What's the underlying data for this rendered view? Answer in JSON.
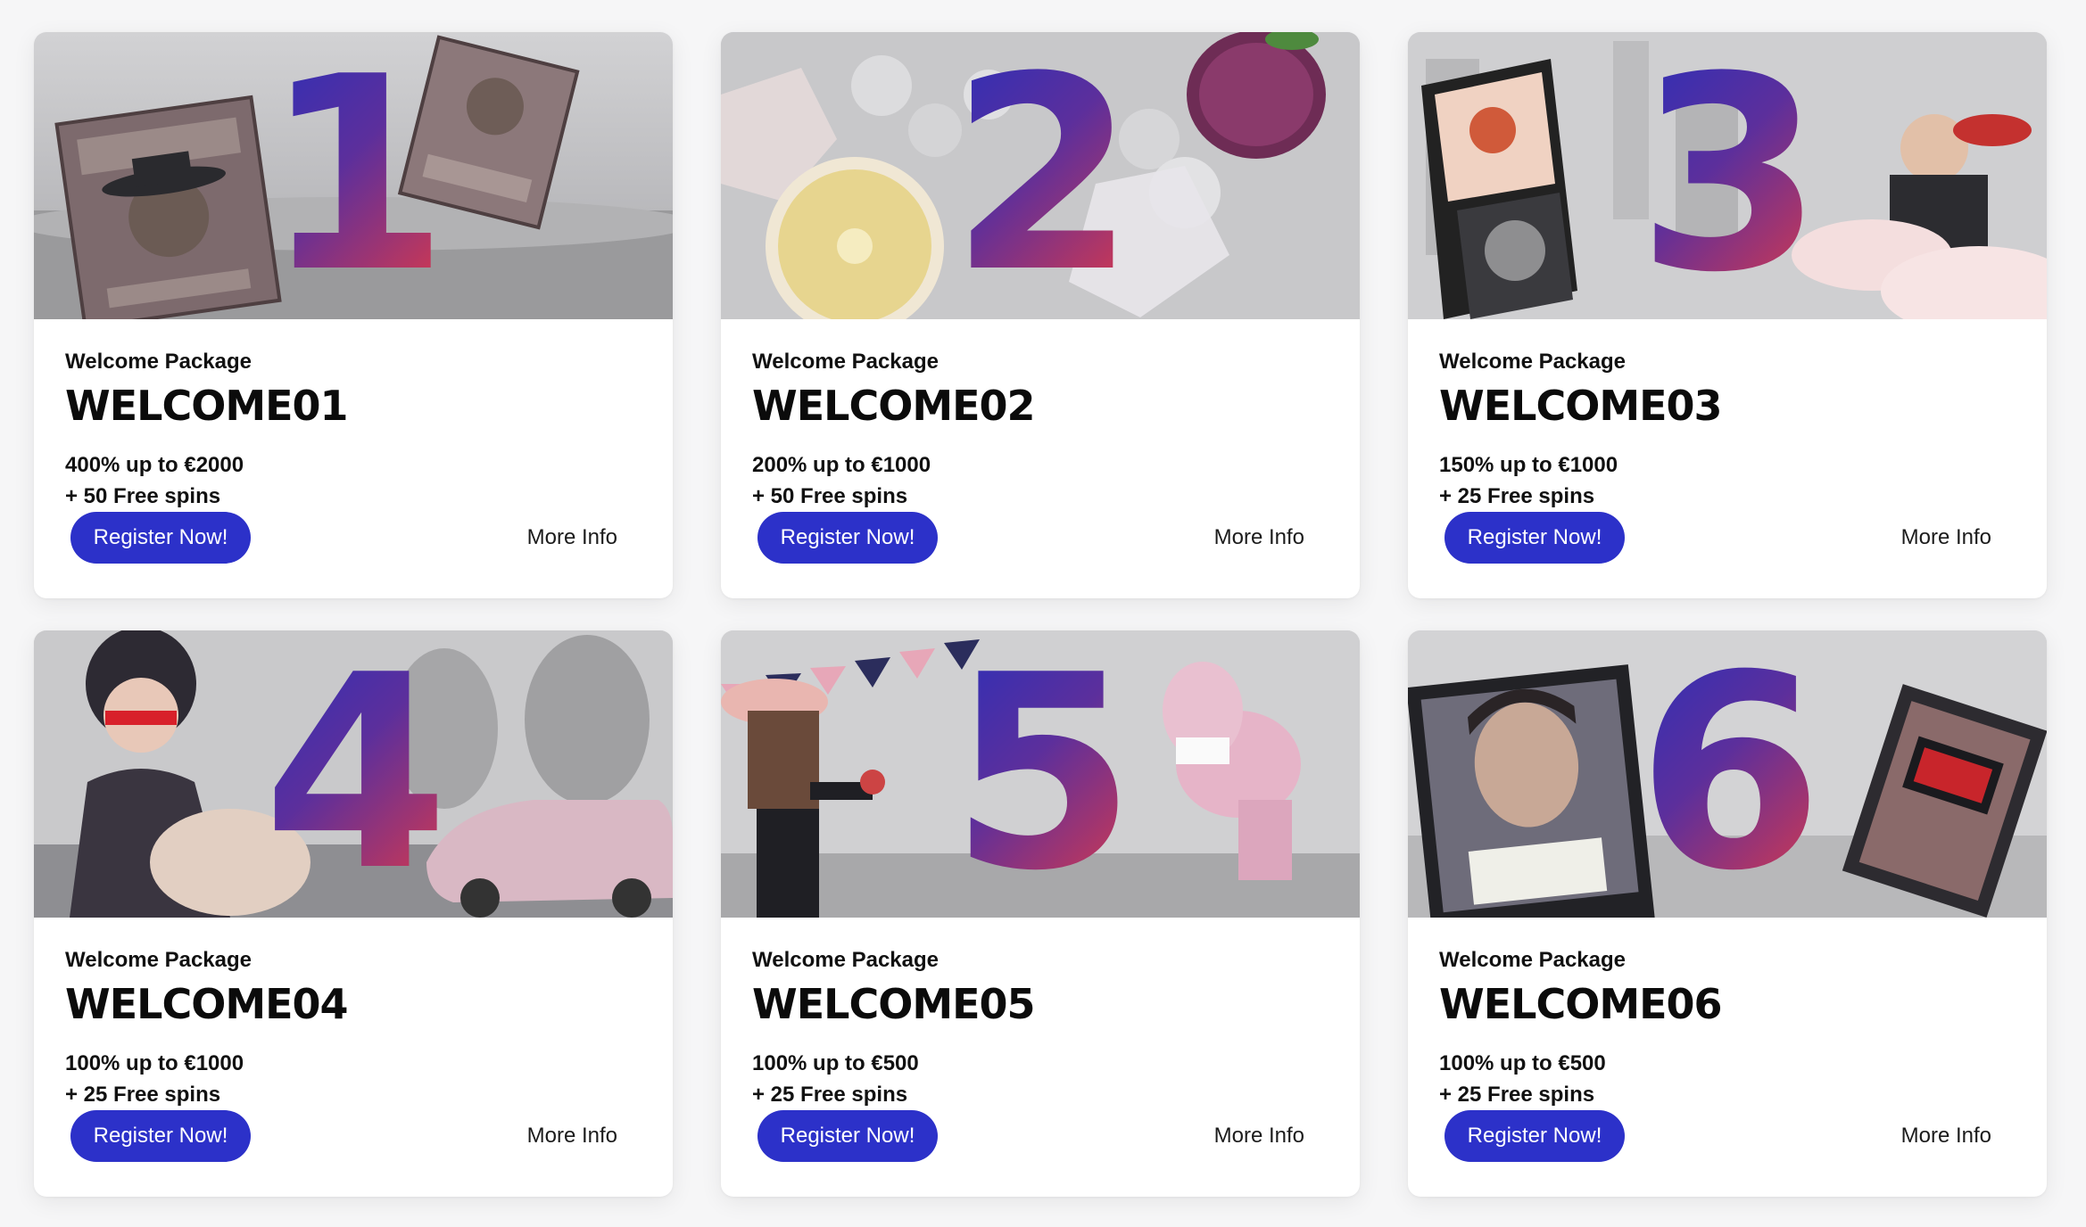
{
  "cards": [
    {
      "number": "1",
      "label": "Welcome Package",
      "code": "WELCOME01",
      "offer_line1": "400% up to €2000",
      "offer_line2": "+ 50 Free spins",
      "register_label": "Register Now!",
      "more_label": "More Info"
    },
    {
      "number": "2",
      "label": "Welcome Package",
      "code": "WELCOME02",
      "offer_line1": "200% up to €1000",
      "offer_line2": "+ 50 Free spins",
      "register_label": "Register Now!",
      "more_label": "More Info"
    },
    {
      "number": "3",
      "label": "Welcome Package",
      "code": "WELCOME03",
      "offer_line1": "150% up to €1000",
      "offer_line2": "+ 25 Free spins",
      "register_label": "Register Now!",
      "more_label": "More Info"
    },
    {
      "number": "4",
      "label": "Welcome Package",
      "code": "WELCOME04",
      "offer_line1": "100% up to €1000",
      "offer_line2": "+ 25 Free spins",
      "register_label": "Register Now!",
      "more_label": "More Info"
    },
    {
      "number": "5",
      "label": "Welcome Package",
      "code": "WELCOME05",
      "offer_line1": "100% up to €500",
      "offer_line2": "+ 25 Free spins",
      "register_label": "Register Now!",
      "more_label": "More Info"
    },
    {
      "number": "6",
      "label": "Welcome Package",
      "code": "WELCOME06",
      "offer_line1": "100% up to €500",
      "offer_line2": "+ 25 Free spins",
      "register_label": "Register Now!",
      "more_label": "More Info"
    }
  ],
  "colors": {
    "button_bg": "#2c31c9",
    "number_gradient_start": "#2b2fb8",
    "number_gradient_end": "#e13a46"
  },
  "illustrations": [
    "wanted-posters-western-illustration",
    "fruits-and-ice-illustration",
    "gangster-comic-illustration",
    "spy-woman-and-sports-car-illustration",
    "fiesta-pinata-illustration",
    "narcos-mugshot-and-briefcase-illustration"
  ]
}
